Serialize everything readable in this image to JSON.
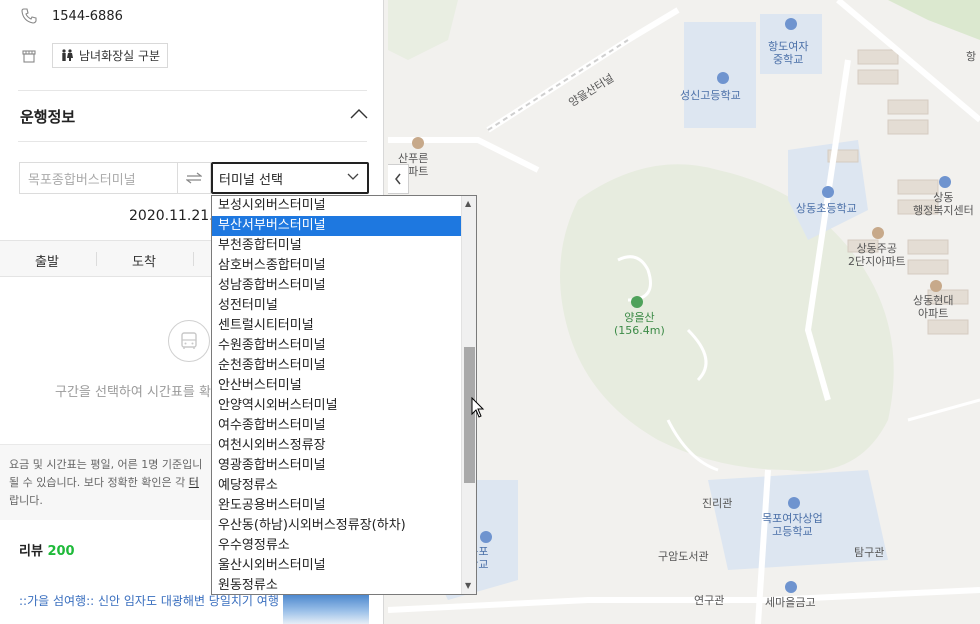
{
  "panel": {
    "phone": "1544-6886",
    "facility_tag": "남녀화장실 구분",
    "section_title": "운행정보",
    "from_placeholder": "목포종합버스터미널",
    "to_select": "터미널 선택",
    "date": "2020.11.21.(",
    "tabs": [
      "출발",
      "도착"
    ],
    "empty_text": "구간을 선택하여 시간표를 확",
    "notice_lines": [
      "요금 및 시간표는 평일, 어른 1명 기준입니",
      "될 수 있습니다. 보다 정확한 확인은 각",
      "랍니다."
    ],
    "notice_link": "터",
    "review_label": "리뷰",
    "review_count": "200",
    "review_item": "::가을 섬여행:: 신안 임자도 대광해변 당일치기 여행"
  },
  "dropdown": {
    "options": [
      "보성시외버스터미널",
      "부산서부버스터미널",
      "부천종합터미널",
      "삼호버스종합터미널",
      "성남종합버스터미널",
      "성전터미널",
      "센트럴시티터미널",
      "수원종합버스터미널",
      "순천종합버스터미널",
      "안산버스터미널",
      "안양역시외버스터미널",
      "여수종합버스터미널",
      "여천시외버스정류장",
      "영광종합버스터미널",
      "예당정류소",
      "완도공용버스터미널",
      "우산동(하남)시외버스정류장(하차)",
      "우수영정류소",
      "울산시외버스터미널",
      "원동정류소"
    ],
    "selected": "부산서부버스터미널"
  },
  "map": {
    "roads": [
      "양을산터널",
      "양을산터널"
    ],
    "labels": {
      "hangdo": "항도여자\n중학교",
      "seongsin": "성신고등학교",
      "pureun": "산푸른\n아파트",
      "sangdong_ele": "상동초등학교",
      "welfare": "상동\n행정복지센터",
      "jugong": "상동주공\n2단지아파트",
      "hyundai": "상동현대\n아파트",
      "mountain": "양을산\n(156.4m)",
      "jinri": "진리관",
      "mokpo_girls": "목포여자상업\n고등학교",
      "gyodae": "교대목포\n초등학교",
      "library": "구암도서관",
      "tamgu": "탐구관",
      "yeongu": "연구관",
      "saemaeul": "세마을금고",
      "hang": "항"
    }
  },
  "colors": {
    "accent_green": "#1fba3a",
    "select_blue": "#1e78e0",
    "link_blue": "#3a6fbf"
  }
}
